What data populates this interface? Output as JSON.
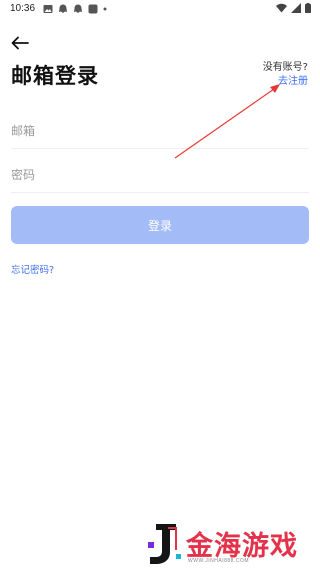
{
  "status_bar": {
    "time": "10:36",
    "icons": [
      "image-icon",
      "ghost-icon",
      "ghost-icon",
      "app-icon",
      "dot-icon"
    ],
    "right_icons": [
      "wifi-icon",
      "signal-icon",
      "battery-icon"
    ]
  },
  "header": {
    "title": "邮箱登录",
    "no_account_text": "没有账号?",
    "register_link": "去注册"
  },
  "form": {
    "email_placeholder": "邮箱",
    "password_placeholder": "密码",
    "login_button": "登录",
    "forgot_password": "忘记密码?"
  },
  "colors": {
    "accent": "#3d6ff3",
    "button_disabled": "#a3bbf7",
    "annotation": "#e53935",
    "watermark": "#e4324a"
  },
  "watermark": {
    "text": "金海游戏",
    "sub": "WWW.JINHAI888.COM"
  }
}
